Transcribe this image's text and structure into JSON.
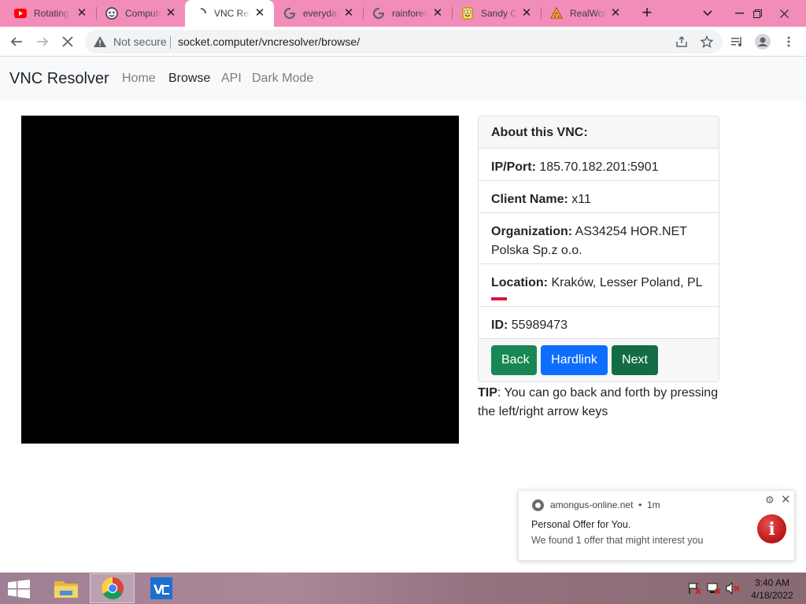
{
  "browser": {
    "tabs": [
      {
        "title": "Rotating",
        "favicon": "youtube-icon"
      },
      {
        "title": "Computer",
        "favicon": "computer-icon"
      },
      {
        "title": "VNC Resolver",
        "favicon": "loading-icon",
        "active": true
      },
      {
        "title": "everyday",
        "favicon": "google-icon"
      },
      {
        "title": "rainforest",
        "favicon": "google-icon"
      },
      {
        "title": "Sandy Cheeks",
        "favicon": "spongebob-icon"
      },
      {
        "title": "RealWorld",
        "favicon": "pizza-icon"
      }
    ],
    "security_label": "Not secure",
    "url": "socket.computer/vncresolver/browse/"
  },
  "navbar": {
    "brand": "VNC Resolver",
    "links": [
      "Home",
      "Browse",
      "API",
      "Dark Mode"
    ],
    "active_link": "Browse"
  },
  "card": {
    "header": "About this VNC:",
    "ip_label": "IP/Port:",
    "ip_value": "185.70.182.201:5901",
    "client_label": "Client Name:",
    "client_value": "x11",
    "org_label": "Organization:",
    "org_value": "AS34254 HOR.NET Polska Sp.z o.o.",
    "location_label": "Location:",
    "location_value": "Kraków, Lesser Poland, PL",
    "id_label": "ID:",
    "id_value": "55989473",
    "buttons": {
      "back": "Back",
      "hardlink": "Hardlink",
      "next": "Next"
    }
  },
  "tip": {
    "label": "TIP",
    "text": ": You can go back and forth by pressing the left/right arrow keys"
  },
  "notification": {
    "site": "amongus-online.net",
    "time": "1m",
    "title": "Personal Offer for You.",
    "body": "We found 1 offer that might interest you"
  },
  "taskbar": {
    "time": "3:40 AM",
    "date": "4/18/2022"
  },
  "colors": {
    "tabstrip": "#f28cb9",
    "btn_back": "#198754",
    "btn_hardlink": "#0d6efd",
    "btn_next": "#146c43"
  }
}
